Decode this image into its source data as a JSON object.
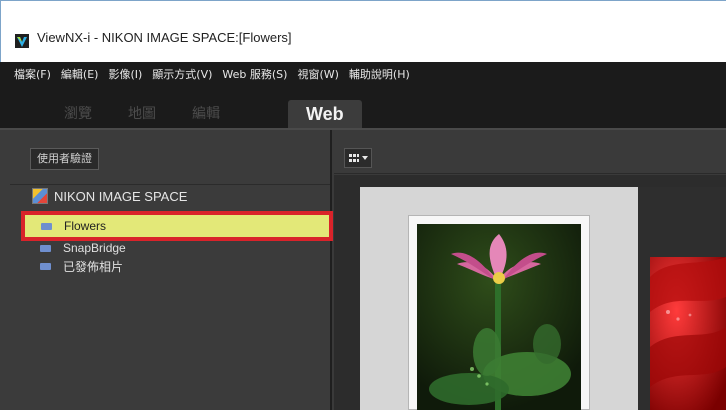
{
  "window": {
    "title": "ViewNX-i - NIKON IMAGE SPACE:[Flowers]"
  },
  "menu": {
    "items": [
      "檔案(F)",
      "編輯(E)",
      "影像(I)",
      "顯示方式(V)",
      "Web 服務(S)",
      "視窗(W)",
      "輔助說明(H)"
    ]
  },
  "tabs": [
    {
      "label": "瀏覽",
      "active": false
    },
    {
      "label": "地圖",
      "active": false
    },
    {
      "label": "編輯",
      "active": false
    },
    {
      "label": "Web",
      "active": true
    }
  ],
  "left_panel": {
    "auth_button": "使用者驗證",
    "tree_root": "NIKON IMAGE SPACE",
    "folders": [
      "Flowers",
      "SnapBridge",
      "已發佈相片"
    ],
    "selected_folder": "Flowers"
  },
  "main": {
    "view_button_icon": "grid-icon"
  },
  "colors": {
    "selection_fill": "#e3e878",
    "selection_outline": "#d9232a",
    "menu_bg": "#1b1b1b",
    "panel_bg": "#3b3b3b"
  }
}
